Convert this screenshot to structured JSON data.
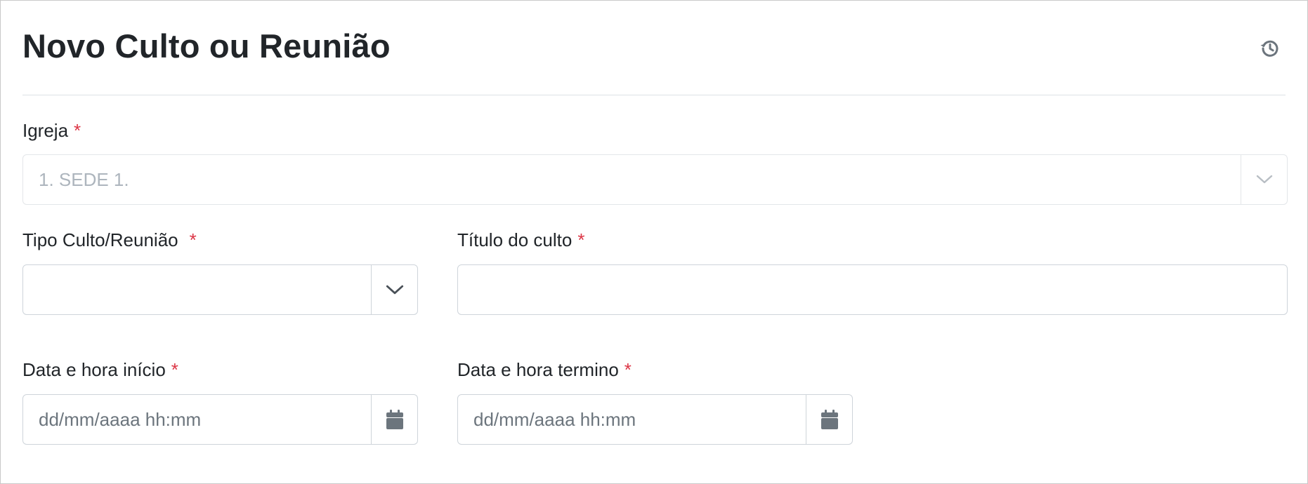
{
  "header": {
    "title": "Novo Culto ou Reunião",
    "history_icon": "history-icon"
  },
  "form": {
    "igreja": {
      "label": "Igreja",
      "required_mark": "*",
      "value": "1. SEDE 1.",
      "disabled": true
    },
    "tipo": {
      "label": "Tipo Culto/Reunião",
      "required_mark": "*",
      "value": ""
    },
    "titulo": {
      "label": "Título do culto",
      "required_mark": "*",
      "value": ""
    },
    "inicio": {
      "label": "Data e hora início",
      "required_mark": "*",
      "placeholder": "dd/mm/aaaa hh:mm"
    },
    "termino": {
      "label": "Data e hora termino",
      "required_mark": "*",
      "placeholder": "dd/mm/aaaa hh:mm"
    }
  },
  "colors": {
    "required": "#dc3545",
    "border": "#ced4da",
    "icon": "#6c757d"
  }
}
